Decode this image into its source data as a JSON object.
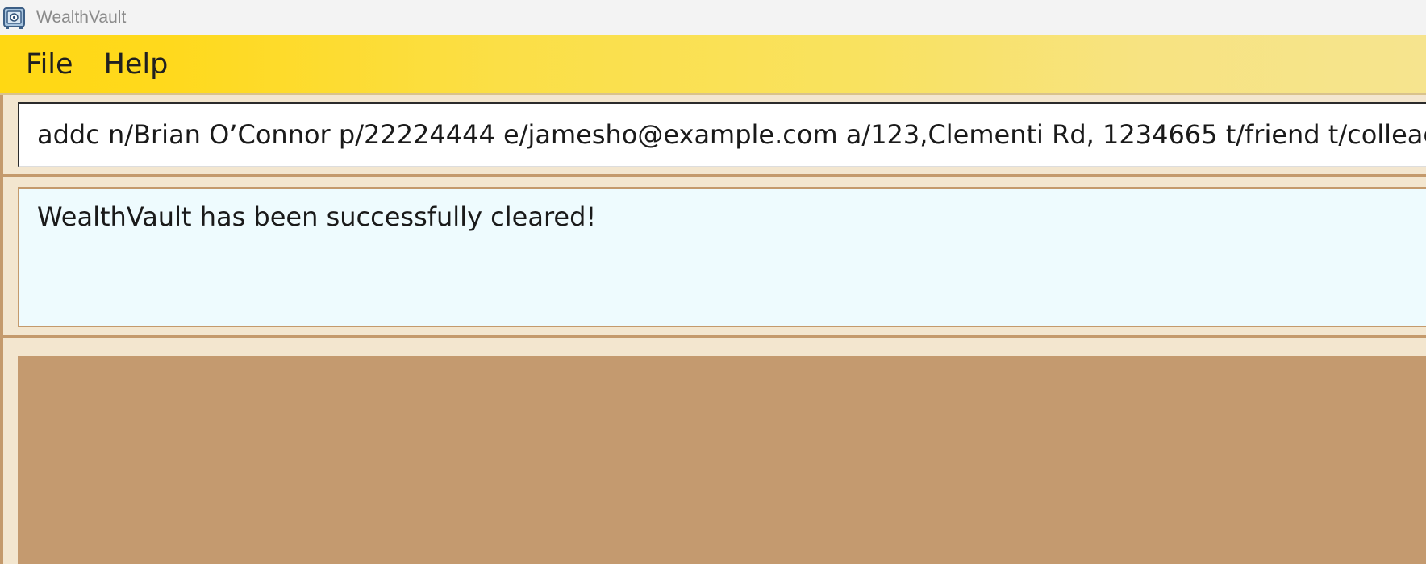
{
  "window": {
    "title": "WealthVault",
    "icon": "vault-safe-icon"
  },
  "menu": {
    "items": [
      {
        "label": "File"
      },
      {
        "label": "Help"
      }
    ]
  },
  "command_box": {
    "value": "addc n/Brian O’Connor p/22224444 e/jamesho@example.com a/123,Clementi Rd, 1234665 t/friend t/colleague"
  },
  "result_display": {
    "message": "WealthVault has been successfully cleared!"
  },
  "colors": {
    "menubar_start": "#ffd813",
    "menubar_end": "#f6e48e",
    "background": "#f3e6cf",
    "accent_border": "#c49a6c",
    "result_background": "#eefbfe",
    "list_panel": "#c49a6f"
  }
}
